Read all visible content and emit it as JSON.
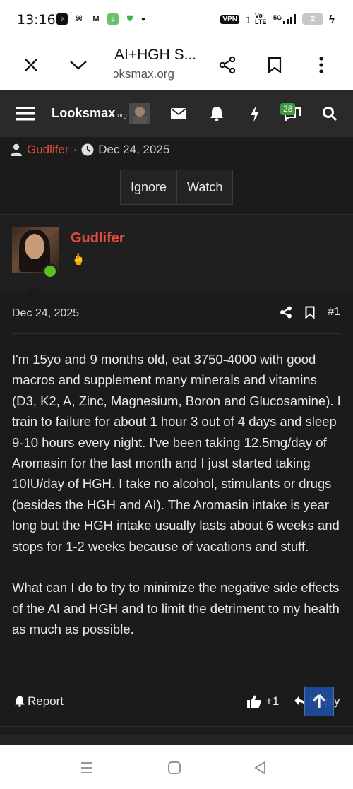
{
  "status_bar": {
    "time": "13:16",
    "vpn_label": "VPN",
    "network": "5G",
    "volte": "Vo LTE",
    "battery": "2"
  },
  "browser": {
    "title": "AI+HGH S...",
    "url": "ɔksmax.org"
  },
  "site": {
    "logo_text": "Looksmax",
    "logo_suffix": ".org",
    "alerts_badge": "28"
  },
  "thread": {
    "author": "Gudlifer",
    "separator": "·",
    "date": "Dec 24, 2025",
    "ignore_label": "Ignore",
    "watch_label": "Watch"
  },
  "post": {
    "username": "Gudlifer",
    "user_icon": "🖕",
    "date": "Dec 24, 2025",
    "number": "#1",
    "paragraphs": [
      "I'm 15yo and 9 months old, eat 3750-4000 with good macros and supplement many minerals and vitamins (D3, K2, A, Zinc, Magnesium, Boron and Glucosamine). I train to failure for about 1 hour 3 out of 4 days and sleep 9-10 hours every night. I've been taking 12.5mg/day of Aromasin for the last month and I just started taking 10IU/day of HGH. I take no alcohol, stimulants or drugs (besides the HGH and AI). The Aromasin intake is year long but the HGH intake usually lasts about 6 weeks and stops for 1-2 weeks because of vacations and stuff.",
      "What can I do to try to minimize the negative side effects of the AI and HGH and to limit the detriment to my health as much as possible."
    ],
    "report_label": "Report",
    "like_count": "+1",
    "reply_label": "Reply"
  },
  "colors": {
    "accent_red": "#e74c3c",
    "online_green": "#5fbf1f",
    "badge_green": "#3d9a3d",
    "scroll_top_blue": "#1f4f9e"
  }
}
